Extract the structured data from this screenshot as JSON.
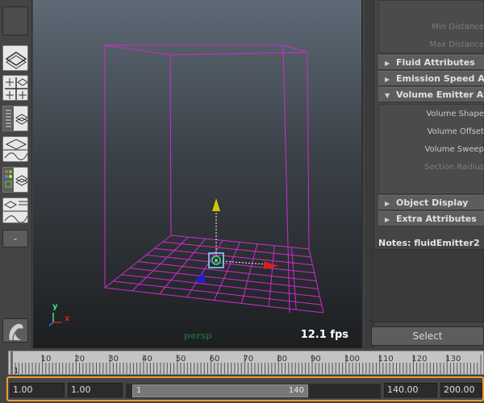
{
  "viewport": {
    "camera_label": "persp",
    "fps": "12.1 fps",
    "axis_labels": {
      "x": "x",
      "y": "y"
    }
  },
  "attribute_editor": {
    "rows_top": [
      "Min Distance",
      "Max Distance"
    ],
    "sections": [
      {
        "label": "Fluid Attributes",
        "expanded": false
      },
      {
        "label": "Emission Speed Attributes",
        "expanded": false
      },
      {
        "label": "Volume Emitter Attributes",
        "expanded": true
      },
      {
        "label": "Object Display",
        "expanded": false
      },
      {
        "label": "Extra Attributes",
        "expanded": false
      }
    ],
    "volume_rows": [
      "Volume Shape",
      "Volume Offset",
      "Volume Sweep",
      "Section Radius"
    ],
    "notes_label": "Notes:  fluidEmitter2",
    "select_button": "Select"
  },
  "time_slider": {
    "current_frame": "1",
    "ticks": [
      "10",
      "20",
      "30",
      "40",
      "50",
      "60",
      "70",
      "80",
      "90",
      "100",
      "110",
      "120",
      "130"
    ]
  },
  "range_slider": {
    "start_time": "1.00",
    "playback_start": "1.00",
    "handle_start": "1",
    "handle_end": "140",
    "playback_end": "140.00",
    "end_time": "200.00"
  },
  "colors": {
    "highlight": "#f09a2d",
    "wireframe": "#d12bd1",
    "axis_x": "#d42020",
    "axis_y": "#d4c800",
    "axis_z": "#2020d0"
  },
  "icons": {
    "tool_render": "render-layer-icon",
    "tool_grid": "four-view-icon",
    "tool_outliner": "outliner-icon",
    "tool_graph": "graph-editor-icon",
    "tool_hypershade": "hypershade-icon",
    "maya_logo": "maya-logo-icon"
  }
}
